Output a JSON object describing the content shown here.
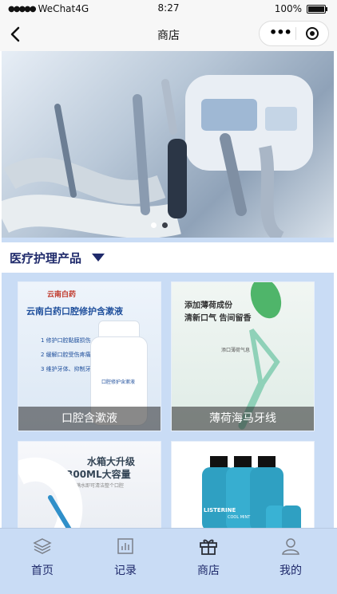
{
  "status_bar": {
    "carrier": "WeChat4G",
    "time": "8:27",
    "battery": "100%"
  },
  "nav": {
    "title": "商店"
  },
  "banner": {
    "dots": 2,
    "active_dot": 0
  },
  "category": {
    "title": "医疗护理产品"
  },
  "products": [
    {
      "name": "口腔含漱液",
      "brand_logo_text": "云南白药",
      "headline": "云南白药口腔修护含漱液",
      "bullets": [
        "1 修护口腔黏膜损伤",
        "2 缓解口腔受伤疼痛",
        "3 维护牙体、抑制牙龈肿痛"
      ],
      "bottle_label": "口腔修护含漱液"
    },
    {
      "name": "薄荷海马牙线",
      "headline_1": "添加薄荷成份",
      "headline_2": "清新口气 告间留香",
      "tag": "添口薄荷气息"
    },
    {
      "name": "",
      "headline_1": "水箱大升级",
      "headline_2": "300ML大容量",
      "caption": "一次满水即可清洁整个口腔"
    },
    {
      "name": "",
      "bottle_brand": "LISTERINE",
      "bottle_sub": "COOL MINT"
    }
  ],
  "tabs": [
    {
      "label": "首页",
      "icon": "layers-icon"
    },
    {
      "label": "记录",
      "icon": "chart-icon"
    },
    {
      "label": "商店",
      "icon": "gift-icon"
    },
    {
      "label": "我的",
      "icon": "user-icon"
    }
  ],
  "colors": {
    "accent": "#1f2a6b",
    "background": "#c9dcf5"
  }
}
